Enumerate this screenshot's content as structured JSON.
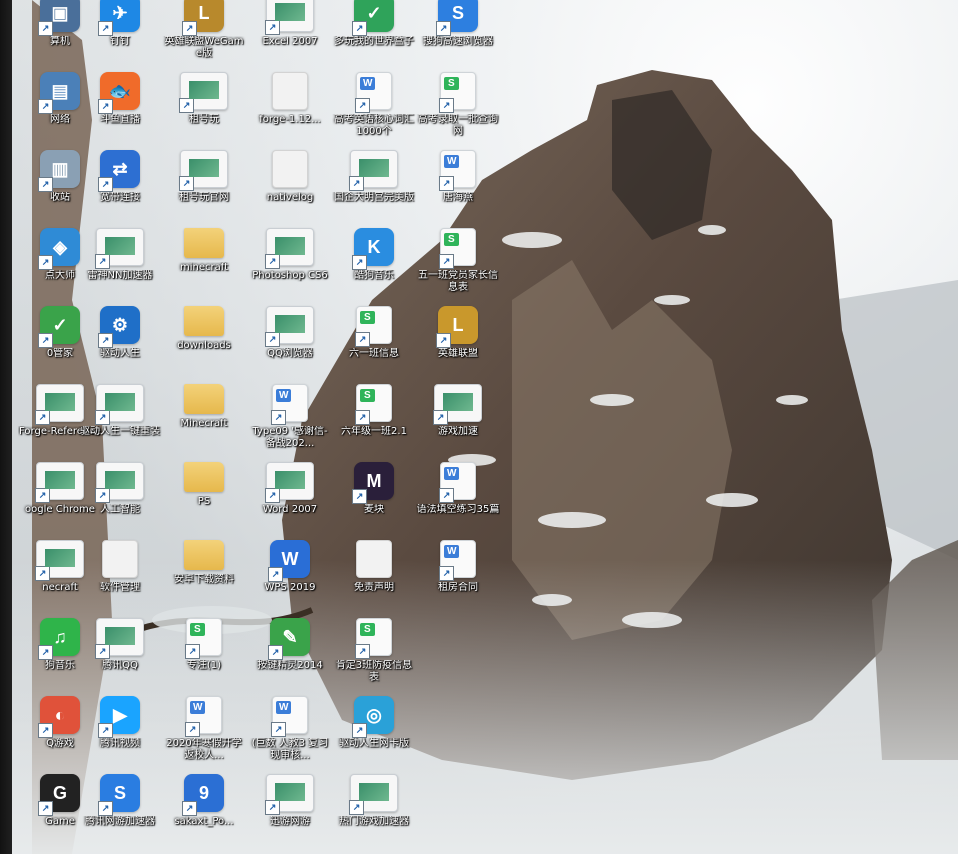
{
  "desktop": {
    "icons": [
      {
        "col": 0,
        "row": 0,
        "label": "算机",
        "kind": "app",
        "color": "#4a6f9a",
        "glyph": "▣"
      },
      {
        "col": 0,
        "row": 1,
        "label": "网络",
        "kind": "app",
        "color": "#4b80b8",
        "glyph": "▤"
      },
      {
        "col": 0,
        "row": 2,
        "label": "收站",
        "kind": "app",
        "color": "#8aa0b4",
        "glyph": "▥"
      },
      {
        "col": 0,
        "row": 3,
        "label": "点大师",
        "kind": "app",
        "color": "#2f8bd6",
        "glyph": "◈"
      },
      {
        "col": 0,
        "row": 4,
        "label": "0管家",
        "kind": "app",
        "color": "#3aa34a",
        "glyph": "✓"
      },
      {
        "col": 0,
        "row": 5,
        "label": "Forge-Reference",
        "kind": "shortcut"
      },
      {
        "col": 0,
        "row": 6,
        "label": "oogle Chrome",
        "kind": "shortcut"
      },
      {
        "col": 0,
        "row": 7,
        "label": "necraft",
        "kind": "shortcut"
      },
      {
        "col": 0,
        "row": 8,
        "label": "狗音乐",
        "kind": "app",
        "color": "#2fb44a",
        "glyph": "♫"
      },
      {
        "col": 0,
        "row": 9,
        "label": "Q游戏",
        "kind": "app",
        "color": "#e0523a",
        "glyph": "◐"
      },
      {
        "col": 0,
        "row": 10,
        "label": "Game",
        "kind": "app",
        "color": "#222",
        "glyph": "G"
      },
      {
        "col": 1,
        "row": 0,
        "label": "钉钉",
        "kind": "app",
        "color": "#1e88e5",
        "glyph": "✈"
      },
      {
        "col": 1,
        "row": 1,
        "label": "斗鱼直播",
        "kind": "app",
        "color": "#f06b2a",
        "glyph": "🐟"
      },
      {
        "col": 1,
        "row": 2,
        "label": "宽带连接",
        "kind": "app",
        "color": "#2d6fd2",
        "glyph": "⇄"
      },
      {
        "col": 1,
        "row": 3,
        "label": "雷神NN加速器",
        "kind": "shortcut"
      },
      {
        "col": 1,
        "row": 4,
        "label": "驱动人生",
        "kind": "app",
        "color": "#1f6fc8",
        "glyph": "⚙"
      },
      {
        "col": 1,
        "row": 5,
        "label": "驱动人生一键重装",
        "kind": "shortcut"
      },
      {
        "col": 1,
        "row": 6,
        "label": "人工智能",
        "kind": "shortcut"
      },
      {
        "col": 1,
        "row": 7,
        "label": "软件管理",
        "kind": "txt"
      },
      {
        "col": 1,
        "row": 8,
        "label": "腾讯QQ",
        "kind": "shortcut"
      },
      {
        "col": 1,
        "row": 9,
        "label": "腾讯视频",
        "kind": "app",
        "color": "#1aa4ff",
        "glyph": "▶"
      },
      {
        "col": 1,
        "row": 10,
        "label": "腾讯网游加速器",
        "kind": "app",
        "color": "#2a7de1",
        "glyph": "S"
      },
      {
        "col": 2,
        "row": 0,
        "label": "英雄联盟WeGame版",
        "kind": "app",
        "color": "#b8892c",
        "glyph": "L"
      },
      {
        "col": 2,
        "row": 1,
        "label": "租号玩",
        "kind": "shortcut"
      },
      {
        "col": 2,
        "row": 2,
        "label": "租号玩官网",
        "kind": "shortcut"
      },
      {
        "col": 2,
        "row": 3,
        "label": "minecraft",
        "kind": "folder"
      },
      {
        "col": 2,
        "row": 4,
        "label": "downloads",
        "kind": "folder"
      },
      {
        "col": 2,
        "row": 5,
        "label": "Minecraft",
        "kind": "folder"
      },
      {
        "col": 2,
        "row": 6,
        "label": "PS",
        "kind": "folder"
      },
      {
        "col": 2,
        "row": 7,
        "label": "安卓下载资料",
        "kind": "folder"
      },
      {
        "col": 2,
        "row": 8,
        "label": "专注(1)",
        "kind": "doc-s"
      },
      {
        "col": 2,
        "row": 9,
        "label": "2020年寒假开学返校人...",
        "kind": "doc-w"
      },
      {
        "col": 2,
        "row": 10,
        "label": "sakaxt_Po...",
        "kind": "app",
        "color": "#2b6fd4",
        "glyph": "9"
      },
      {
        "col": 3,
        "row": 0,
        "label": "Excel 2007",
        "kind": "shortcut"
      },
      {
        "col": 3,
        "row": 1,
        "label": "forge-1.12...",
        "kind": "txt"
      },
      {
        "col": 3,
        "row": 2,
        "label": "nativelog",
        "kind": "txt"
      },
      {
        "col": 3,
        "row": 3,
        "label": "Photoshop CS6",
        "kind": "shortcut"
      },
      {
        "col": 3,
        "row": 4,
        "label": "QQ浏览器",
        "kind": "shortcut"
      },
      {
        "col": 3,
        "row": 5,
        "label": "Type09 '感谢信-备战202...",
        "kind": "doc-w"
      },
      {
        "col": 3,
        "row": 6,
        "label": "Word 2007",
        "kind": "shortcut"
      },
      {
        "col": 3,
        "row": 7,
        "label": "WPS 2019",
        "kind": "app",
        "color": "#2a6ed6",
        "glyph": "W"
      },
      {
        "col": 3,
        "row": 8,
        "label": "按键精灵2014",
        "kind": "app",
        "color": "#3aa34a",
        "glyph": "✎"
      },
      {
        "col": 3,
        "row": 9,
        "label": "(巨数 人教3 复习现审核...",
        "kind": "doc-w"
      },
      {
        "col": 3,
        "row": 10,
        "label": "迅游网游",
        "kind": "shortcut"
      },
      {
        "col": 4,
        "row": 0,
        "label": "多玩我的世界盒子",
        "kind": "app",
        "color": "#2fa35a",
        "glyph": "✓"
      },
      {
        "col": 4,
        "row": 1,
        "label": "高考英语核心词汇1000个",
        "kind": "doc-w"
      },
      {
        "col": 4,
        "row": 2,
        "label": "国企大明宫完美版",
        "kind": "shortcut"
      },
      {
        "col": 4,
        "row": 3,
        "label": "酷狗音乐",
        "kind": "app",
        "color": "#2a8de0",
        "glyph": "K"
      },
      {
        "col": 4,
        "row": 4,
        "label": "六一班信息",
        "kind": "doc-s"
      },
      {
        "col": 4,
        "row": 5,
        "label": "六年级一班2.1",
        "kind": "doc-s"
      },
      {
        "col": 4,
        "row": 6,
        "label": "麦块",
        "kind": "app",
        "color": "#2a1f3a",
        "glyph": "M"
      },
      {
        "col": 4,
        "row": 7,
        "label": "免责声明",
        "kind": "txt"
      },
      {
        "col": 4,
        "row": 8,
        "label": "肯定3班防疫信息表",
        "kind": "doc-s"
      },
      {
        "col": 4,
        "row": 9,
        "label": "驱动人生网卡版",
        "kind": "app",
        "color": "#2aa1d8",
        "glyph": "◎"
      },
      {
        "col": 4,
        "row": 10,
        "label": "热门游戏加速器",
        "kind": "shortcut"
      },
      {
        "col": 5,
        "row": 0,
        "label": "搜狗高速浏览器",
        "kind": "app",
        "color": "#2d7fe0",
        "glyph": "S"
      },
      {
        "col": 5,
        "row": 1,
        "label": "高考录取一批查询网",
        "kind": "doc-s"
      },
      {
        "col": 5,
        "row": 2,
        "label": "唐海燕",
        "kind": "doc-w"
      },
      {
        "col": 5,
        "row": 3,
        "label": "五一班党员家长信息表",
        "kind": "doc-s"
      },
      {
        "col": 5,
        "row": 4,
        "label": "英雄联盟",
        "kind": "app",
        "color": "#c9982c",
        "glyph": "L"
      },
      {
        "col": 5,
        "row": 5,
        "label": "游戏加速",
        "kind": "shortcut"
      },
      {
        "col": 5,
        "row": 6,
        "label": "语法填空练习35篇",
        "kind": "doc-w"
      },
      {
        "col": 5,
        "row": 7,
        "label": "租房合同",
        "kind": "doc-w"
      }
    ]
  }
}
